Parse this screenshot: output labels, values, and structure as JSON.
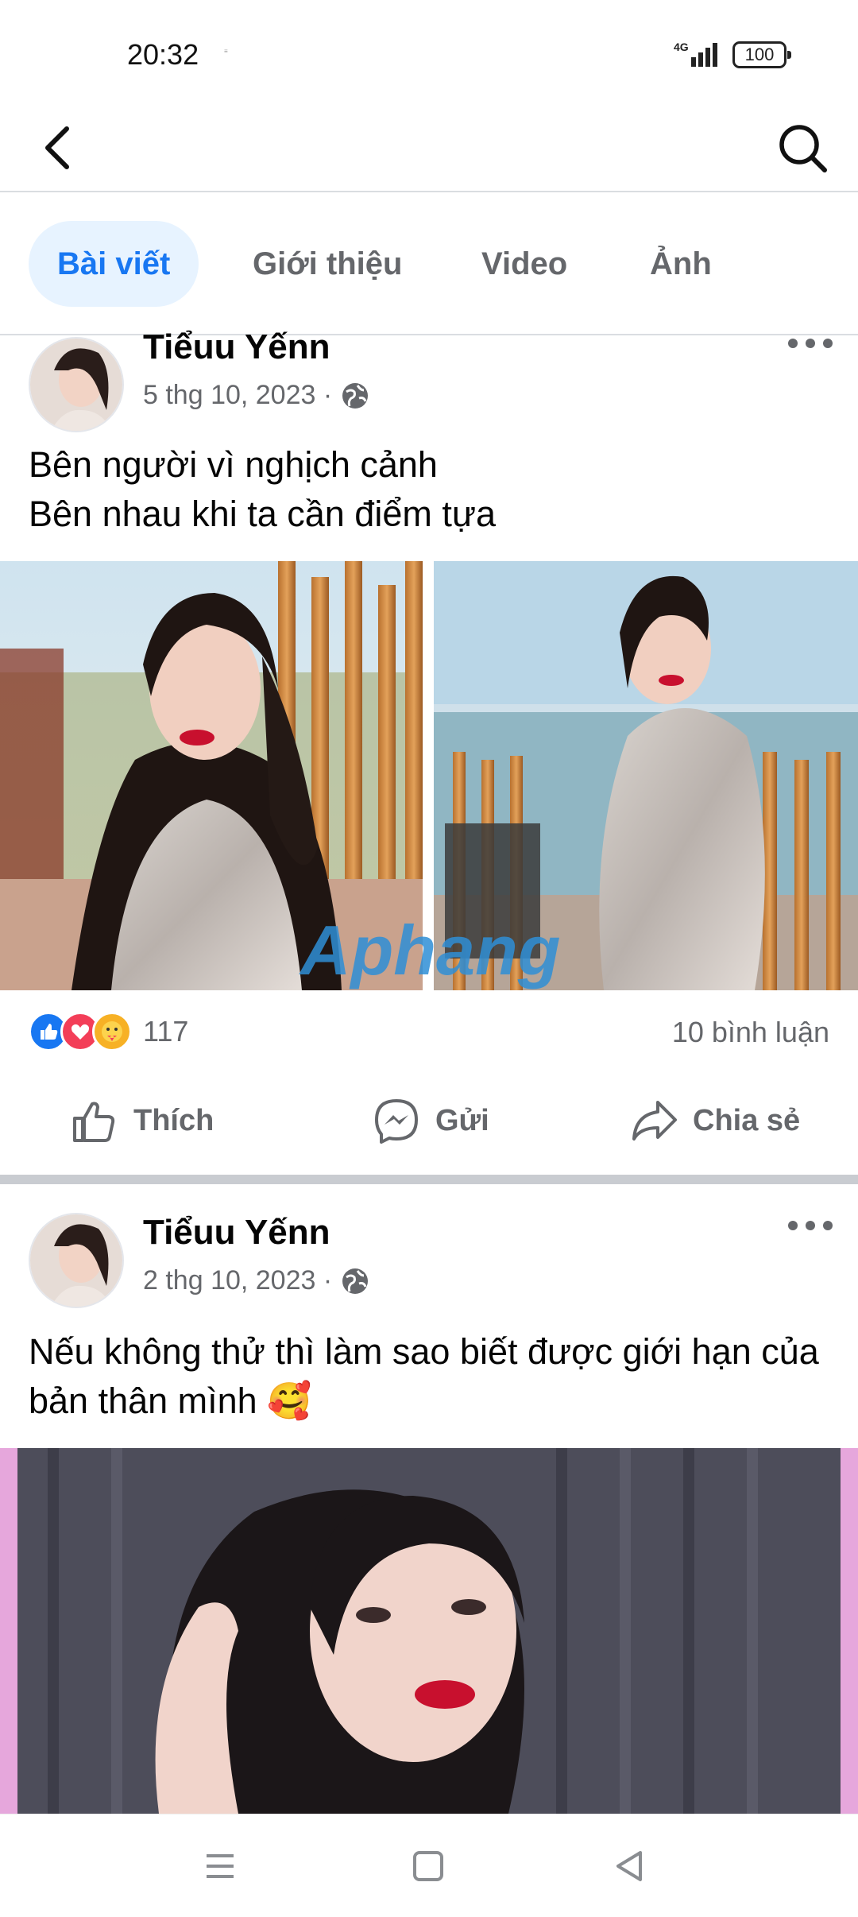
{
  "status_bar": {
    "time": "20:32",
    "network_label": "4G",
    "battery": "100"
  },
  "header": {
    "back_icon": "chevron-left-icon",
    "search_icon": "search-icon"
  },
  "tabs": [
    {
      "label": "Bài viết",
      "active": true
    },
    {
      "label": "Giới thiệu",
      "active": false
    },
    {
      "label": "Video",
      "active": false
    },
    {
      "label": "Ảnh",
      "active": false
    }
  ],
  "posts": [
    {
      "author": "Tiểuu Yếnn",
      "date": "5 thg 10, 2023 ·",
      "text": "Bên người vì nghịch cảnh\nBên nhau khi  ta cần điểm tựa",
      "watermark": "Aphang",
      "reaction_count": "117",
      "comments": "10 bình luận"
    },
    {
      "author": "Tiểuu Yếnn",
      "date": "2 thg 10, 2023 ·",
      "text": "Nếu không thử thì làm sao  biết được giới hạn của bản thân mình 🥰"
    }
  ],
  "actions": {
    "like": "Thích",
    "send": "Gửi",
    "share": "Chia sẻ"
  },
  "colors": {
    "accent": "#1877f2",
    "tab_active_bg": "#e7f3ff",
    "secondary_text": "#65676b"
  }
}
